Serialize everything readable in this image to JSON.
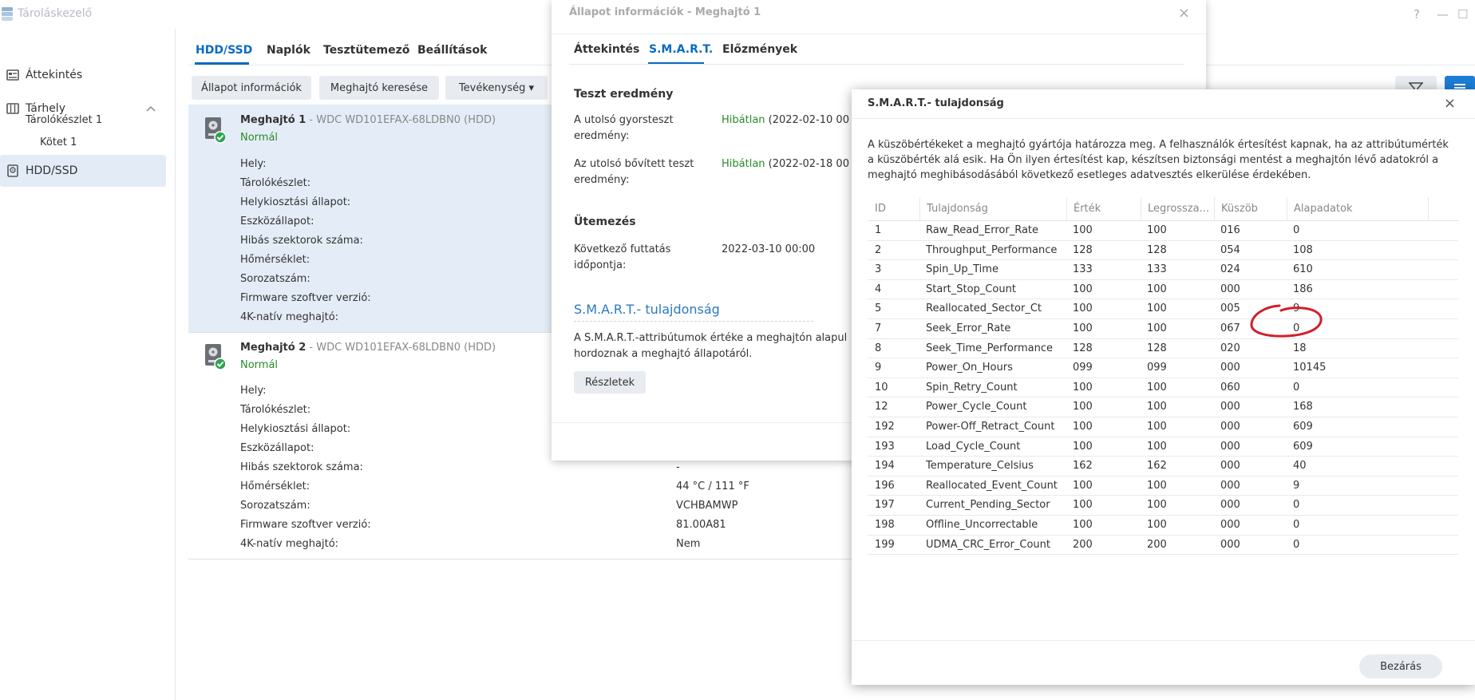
{
  "window": {
    "title": "Tároláskezelő",
    "help": "?",
    "minimize": "—",
    "maximize": "☐"
  },
  "sidebar": {
    "overview": "Áttekintés",
    "storage": "Tárhely",
    "pool": "Tárolókészlet 1",
    "volume": "Kötet 1",
    "hdd": "HDD/SSD"
  },
  "tabs": [
    "HDD/SSD",
    "Naplók",
    "Tesztütemező",
    "Beállítások"
  ],
  "toolbar": {
    "health_info": "Állapot információk",
    "locate": "Meghajtó keresése",
    "action": "Tevékenység ▾"
  },
  "drive_labels": [
    "Hely:",
    "Tárolókészlet:",
    "Helykiosztási állapot:",
    "Eszközállapot:",
    "Hibás szektorok száma:",
    "Hőmérséklet:",
    "Sorozatszám:",
    "Firmware szoftver verzió:",
    "4K-natív meghajtó:"
  ],
  "drive1": {
    "name": "Meghajtó 1",
    "model": " - WDC WD101EFAX-68LDBN0 (HDD)",
    "status": "Normál"
  },
  "drive2": {
    "name": "Meghajtó 2",
    "model": " - WDC WD101EFAX-68LDBN0 (HDD)",
    "status": "Normál",
    "values": {
      "bad_sectors": "-",
      "temperature": "44 °C / 111 °F",
      "serial": "VCHBAMWP",
      "firmware": "81.00A81",
      "native4k": "Nem"
    }
  },
  "health_modal": {
    "title": "Állapot információk - Meghajtó 1",
    "close": "×",
    "tabs": [
      "Áttekintés",
      "S.M.A.R.T.",
      "Előzmények"
    ],
    "test_results": "Teszt eredmény",
    "quick_label_1": "A utolsó gyorsteszt",
    "quick_label_2": "eredmény:",
    "quick_status": "Hibátlan",
    "quick_date": " (2022-02-10 00",
    "ext_label_1": "Az utolsó bővített teszt",
    "ext_label_2": "eredmény:",
    "ext_status": "Hibátlan",
    "ext_date": " (2022-02-18 00",
    "schedule": "Ütemezés",
    "next_label_1": "Következő futtatás",
    "next_label_2": "időpontja:",
    "next_value": "2022-03-10 00:00",
    "smart_heading": "S.M.A.R.T.- tulajdonság",
    "smart_desc_1": "A S.M.A.R.T.-attribútumok értéke a meghajtón alapul",
    "smart_desc_2": "hordoznak a meghajtó állapotáról.",
    "details_button": "Részletek"
  },
  "smart_modal": {
    "title": "S.M.A.R.T.- tulajdonság",
    "close": "×",
    "description": "A küszöbértékeket a meghajtó gyártója határozza meg. A felhasználók értesítést kapnak, ha az attribútumérték a küszöbérték alá esik. Ha Ön ilyen értesítést kap, készítsen biztonsági mentést a meghajtón lévő adatokról a meghajtó meghibásodásából következő esetleges adatvesztés elkerülése érdekében.",
    "columns": [
      "ID",
      "Tulajdonság",
      "Érték",
      "Legrossza...",
      "Küszöb",
      "Alapadatok"
    ],
    "rows": [
      [
        "1",
        "Raw_Read_Error_Rate",
        "100",
        "100",
        "016",
        "0"
      ],
      [
        "2",
        "Throughput_Performance",
        "128",
        "128",
        "054",
        "108"
      ],
      [
        "3",
        "Spin_Up_Time",
        "133",
        "133",
        "024",
        "610"
      ],
      [
        "4",
        "Start_Stop_Count",
        "100",
        "100",
        "000",
        "186"
      ],
      [
        "5",
        "Reallocated_Sector_Ct",
        "100",
        "100",
        "005",
        "9"
      ],
      [
        "7",
        "Seek_Error_Rate",
        "100",
        "100",
        "067",
        "0"
      ],
      [
        "8",
        "Seek_Time_Performance",
        "128",
        "128",
        "020",
        "18"
      ],
      [
        "9",
        "Power_On_Hours",
        "099",
        "099",
        "000",
        "10145"
      ],
      [
        "10",
        "Spin_Retry_Count",
        "100",
        "100",
        "060",
        "0"
      ],
      [
        "12",
        "Power_Cycle_Count",
        "100",
        "100",
        "000",
        "168"
      ],
      [
        "192",
        "Power-Off_Retract_Count",
        "100",
        "100",
        "000",
        "609"
      ],
      [
        "193",
        "Load_Cycle_Count",
        "100",
        "100",
        "000",
        "609"
      ],
      [
        "194",
        "Temperature_Celsius",
        "162",
        "162",
        "000",
        "40"
      ],
      [
        "196",
        "Reallocated_Event_Count",
        "100",
        "100",
        "000",
        "9"
      ],
      [
        "197",
        "Current_Pending_Sector",
        "100",
        "100",
        "000",
        "0"
      ],
      [
        "198",
        "Offline_Uncorrectable",
        "100",
        "100",
        "000",
        "0"
      ],
      [
        "199",
        "UDMA_CRC_Error_Count",
        "200",
        "200",
        "000",
        "0"
      ]
    ],
    "close_button": "Bezárás"
  },
  "colors": {
    "accent": "#0a6bc1",
    "ok": "#2a8a2a",
    "annotation": "#d0202a"
  }
}
